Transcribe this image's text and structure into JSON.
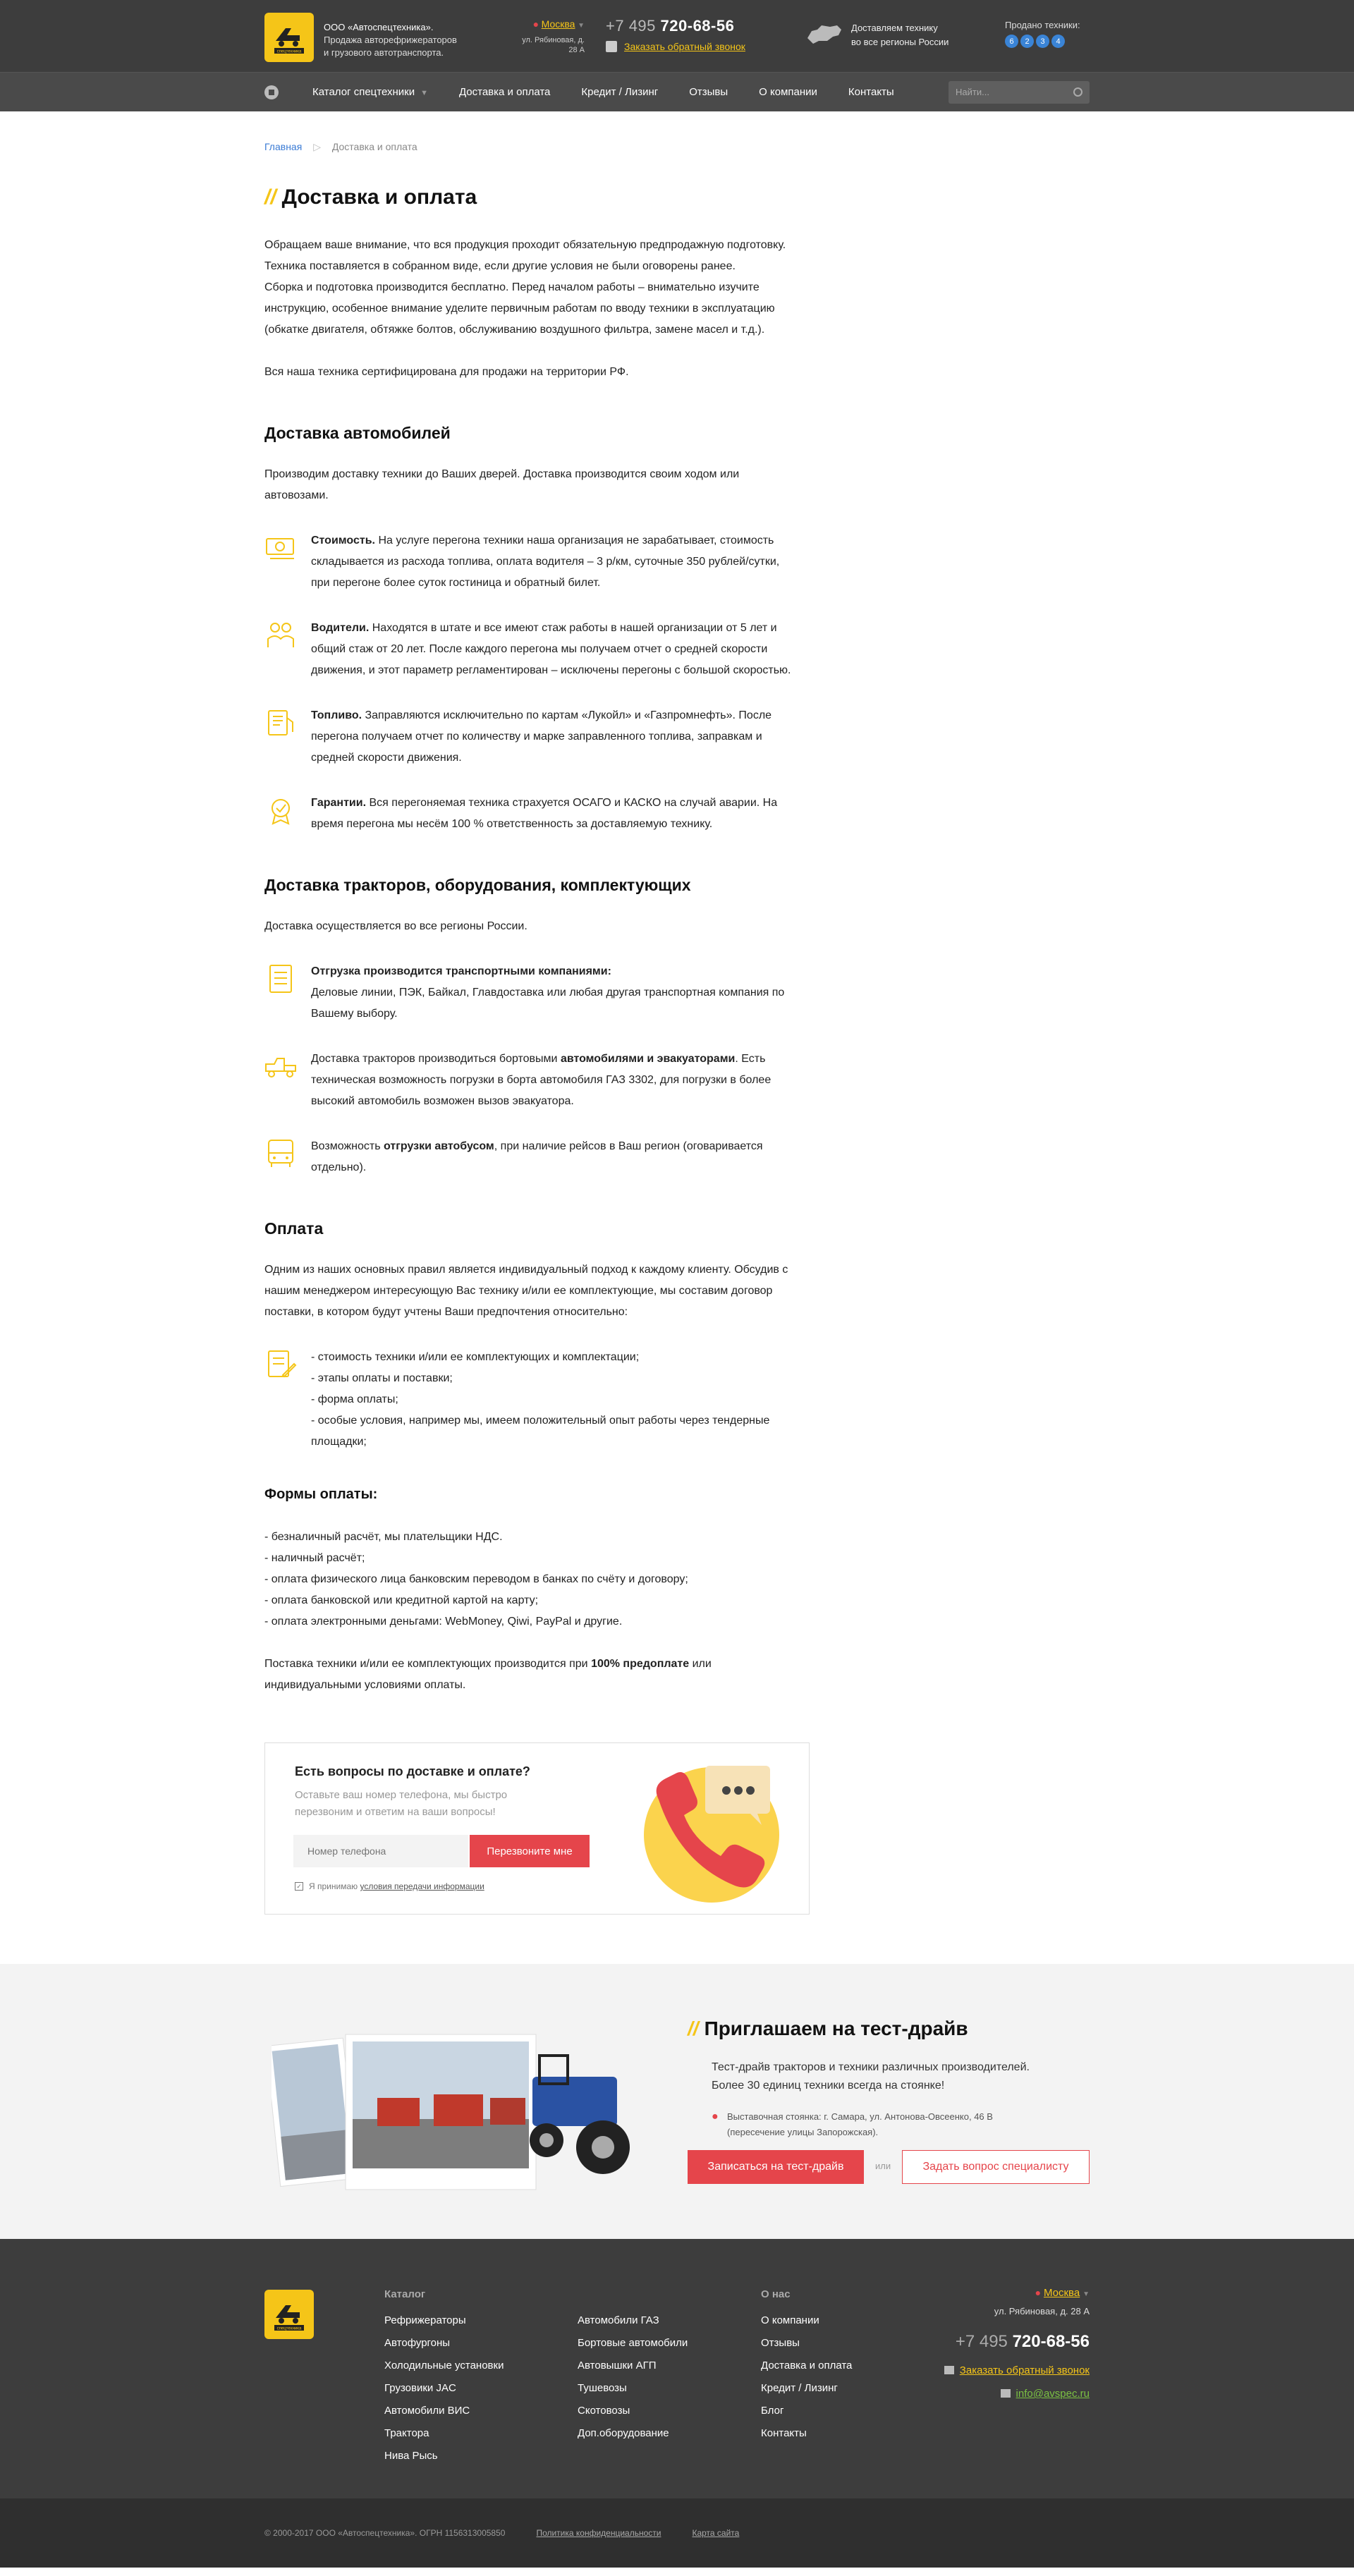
{
  "header": {
    "company_name": "ООО «Автоспецтехника».",
    "company_desc_1": "Продажа авторефрижераторов",
    "company_desc_2": "и грузового автотранспорта.",
    "city": "Москва",
    "address_1": "ул. Рябиновая,",
    "address_2": "д. 28 А",
    "phone_code": "+7 495",
    "phone_number": "720-68-56",
    "callback": "Заказать обратный звонок",
    "deliver_1": "Доставляем технику",
    "deliver_2": "во все регионы России",
    "sold_label": "Продано техники:",
    "sold_digits": [
      "6",
      "2",
      "3",
      "4"
    ],
    "logo_text": "спецтехника"
  },
  "nav": {
    "items": [
      "Каталог спецтехники",
      "Доставка и оплата",
      "Кредит / Лизинг",
      "Отзывы",
      "О компании",
      "Контакты"
    ],
    "search_placeholder": "Найти..."
  },
  "breadcrumb": {
    "home": "Главная",
    "current": "Доставка и оплата"
  },
  "page": {
    "title": "Доставка и оплата",
    "intro": [
      "Обращаем ваше внимание, что вся продукция проходит обязательную предпродажную подготовку.",
      "Техника поставляется в собранном виде, если другие условия не были оговорены ранее.",
      "Сборка и подготовка производится бесплатно. Перед началом работы – внимательно изучите инструкцию, особенное внимание уделите первичным работам по вводу техники в эксплуатацию (обкатке двигателя, обтяжке болтов, обслуживанию воздушного фильтра, замене масел и т.д.)."
    ],
    "certified": "Вся наша техника сертифицирована для продажи на территории РФ.",
    "cars": {
      "title": "Доставка автомобилей",
      "lead": "Производим доставку техники до Ваших дверей. Доставка производится своим ходом или автовозами.",
      "items": [
        {
          "bold": "Стоимость.",
          "text": " На услуге перегона техники наша организация не зарабатывает, стоимость складывается из расхода топлива, оплата водителя – 3 р/км, суточные 350 рублей/сутки, при перегоне более суток гостиница и обратный билет."
        },
        {
          "bold": "Водители.",
          "text": " Находятся в штате и все имеют стаж работы в нашей организации от 5 лет и общий стаж от 20 лет. После каждого перегона мы получаем отчет о средней скорости движения, и этот параметр регламентирован – исключены перегоны с большой скоростью."
        },
        {
          "bold": "Топливо.",
          "text": " Заправляются исключительно по картам «Лукойл» и «Газпромнефть». После перегона получаем отчет по количеству и марке заправленного топлива, заправкам и средней скорости движения."
        },
        {
          "bold": "Гарантии.",
          "text": " Вся перегоняемая техника страхуется ОСАГО и КАСКО на случай аварии. На время перегона мы несём 100 % ответственность за доставляемую технику."
        }
      ]
    },
    "tractors": {
      "title": "Доставка тракторов, оборудования, комплектующих",
      "lead": "Доставка осуществляется во все регионы России.",
      "item1_bold": "Отгрузка производится транспортными компаниями:",
      "item1_text": "Деловые линии, ПЭК, Байкал, Главдоставка или любая другая транспортная компания по Вашему выбору.",
      "item2_pre": "Доставка тракторов производиться бортовыми ",
      "item2_bold": "автомобилями и эвакуаторами",
      "item2_post": ". Есть техническая возможность погрузки в борта автомобиля ГАЗ 3302, для погрузки в более высокий автомобиль возможен вызов эвакуатора.",
      "item3_pre": "Возможность ",
      "item3_bold": "отгрузки автобусом",
      "item3_post": ", при наличие рейсов в Ваш регион (оговаривается отдельно)."
    },
    "payment": {
      "title": "Оплата",
      "lead": "Одним из наших основных правил является индивидуальный подход к каждому клиенту. Обсудив с нашим менеджером интересующую Вас технику и/или ее комплектующие, мы составим договор поставки, в котором будут учтены Ваши предпочтения относительно:",
      "list": [
        "- стоимость техники и/или ее комплектующих и комплектации;",
        "- этапы оплаты и поставки;",
        "- форма оплаты;",
        "- особые условия, например мы, имеем положительный опыт работы через тендерные площадки;"
      ]
    },
    "forms": {
      "title": "Формы оплаты:",
      "list": [
        "- безналичный расчёт, мы плательщики НДС.",
        "- наличный расчёт;",
        "- оплата физического лица банковским переводом в банках по счёту и договору;",
        "- оплата банковской или кредитной картой на карту;",
        "- оплата электронными деньгами: WebMoney, Qiwi, PayPal  и другие."
      ],
      "prepay_pre": "Поставка техники и/или ее комплектующих производится при ",
      "prepay_bold": "100% предоплате",
      "prepay_post": " или индивидуальными условиями оплаты."
    }
  },
  "cta": {
    "title": "Есть вопросы по доставке и оплате?",
    "subtitle": "Оставьте ваш номер телефона, мы быстро перезвоним и ответим на ваши вопросы!",
    "placeholder": "Номер телефона",
    "button": "Перезвоните мне",
    "agree_pre": "Я принимаю ",
    "agree_link": "условия передачи информации"
  },
  "test_drive": {
    "title": "Приглашаем на тест-драйв",
    "text_1": "Тест-драйв тракторов и техники различных производителей.",
    "text_2": "Более 30 единиц техники всегда на стоянке!",
    "addr_1": "Выставочная стоянка: г. Самара, ул. Антонова-Овсеенко, 46 В",
    "addr_2": "(пересечение улицы Запорожская).",
    "btn_primary": "Записаться на тест-драйв",
    "or": "или",
    "btn_secondary": "Задать вопрос специалисту"
  },
  "footer": {
    "catalog_title": "Каталог",
    "catalog_col1": [
      "Рефрижераторы",
      "Автофургоны",
      "Холодильные установки",
      "Грузовики JAC",
      "Автомобили ВИС",
      "Трактора",
      "Нива Рысь"
    ],
    "catalog_col2": [
      "Автомобили ГАЗ",
      "Бортовые автомобили",
      "Автовышки АГП",
      "Тушевозы",
      "Скотовозы",
      "Доп.оборудование"
    ],
    "about_title": "О нас",
    "about": [
      "О компании",
      "Отзывы",
      "Доставка и оплата",
      "Кредит / Лизинг",
      "Блог",
      "Контакты"
    ],
    "city": "Москва",
    "address": "ул. Рябиновая, д. 28 А",
    "phone_code": "+7 495",
    "phone_number": "720-68-56",
    "callback": "Заказать обратный звонок",
    "email": "info@avspec.ru",
    "copyright": "© 2000-2017 ООО «Автоспецтехника». ОГРН 1156313005850",
    "privacy": "Политика конфиденциальности",
    "sitemap": "Карта сайта"
  },
  "colors": {
    "accent": "#f5c518",
    "red": "#e5454b",
    "dark": "#3d3d3d",
    "link": "#3a7bd5"
  }
}
